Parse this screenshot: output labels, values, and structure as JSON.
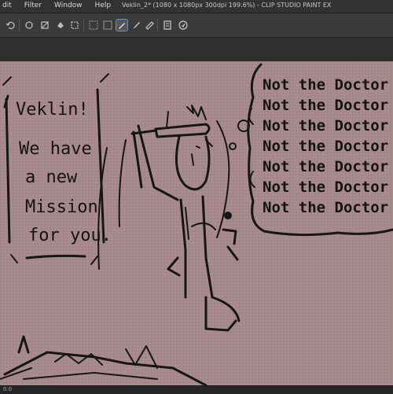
{
  "window": {
    "title": "Veklin_2* (1080 x 1080px 300dpi 199.6%) - CLIP STUDIO PAINT EX"
  },
  "menu": {
    "items": [
      "dit",
      "Filter",
      "Window",
      "Help"
    ]
  },
  "toolbar": {
    "icons": [
      "undo-icon",
      "redo-icon",
      "clear-icon",
      "fill-icon",
      "transform-icon",
      "hide-selection-icon",
      "deselect-icon",
      "pen-tool-icon",
      "brush-tool-icon",
      "eraser-tool-icon",
      "layer-icon",
      "rotate-icon"
    ],
    "active": "pen-tool-icon"
  },
  "artwork": {
    "sign_text": [
      "Veklin!",
      "We have",
      "a new",
      "Mission",
      "for you."
    ],
    "thought_text": [
      "Not the Doctor",
      "Not the Doctor",
      "Not the Doctor",
      "Not the Doctor",
      "Not the Doctor",
      "Not the Doctor",
      "Not the Doctor"
    ],
    "canvas_color": "#aa8c8f",
    "ink_color": "#161616"
  },
  "status": {
    "zoom": "0.0"
  },
  "colors": {
    "titlebar": "#323232",
    "toolbar": "#3a3a3a",
    "accent": "#6b8fc0"
  }
}
